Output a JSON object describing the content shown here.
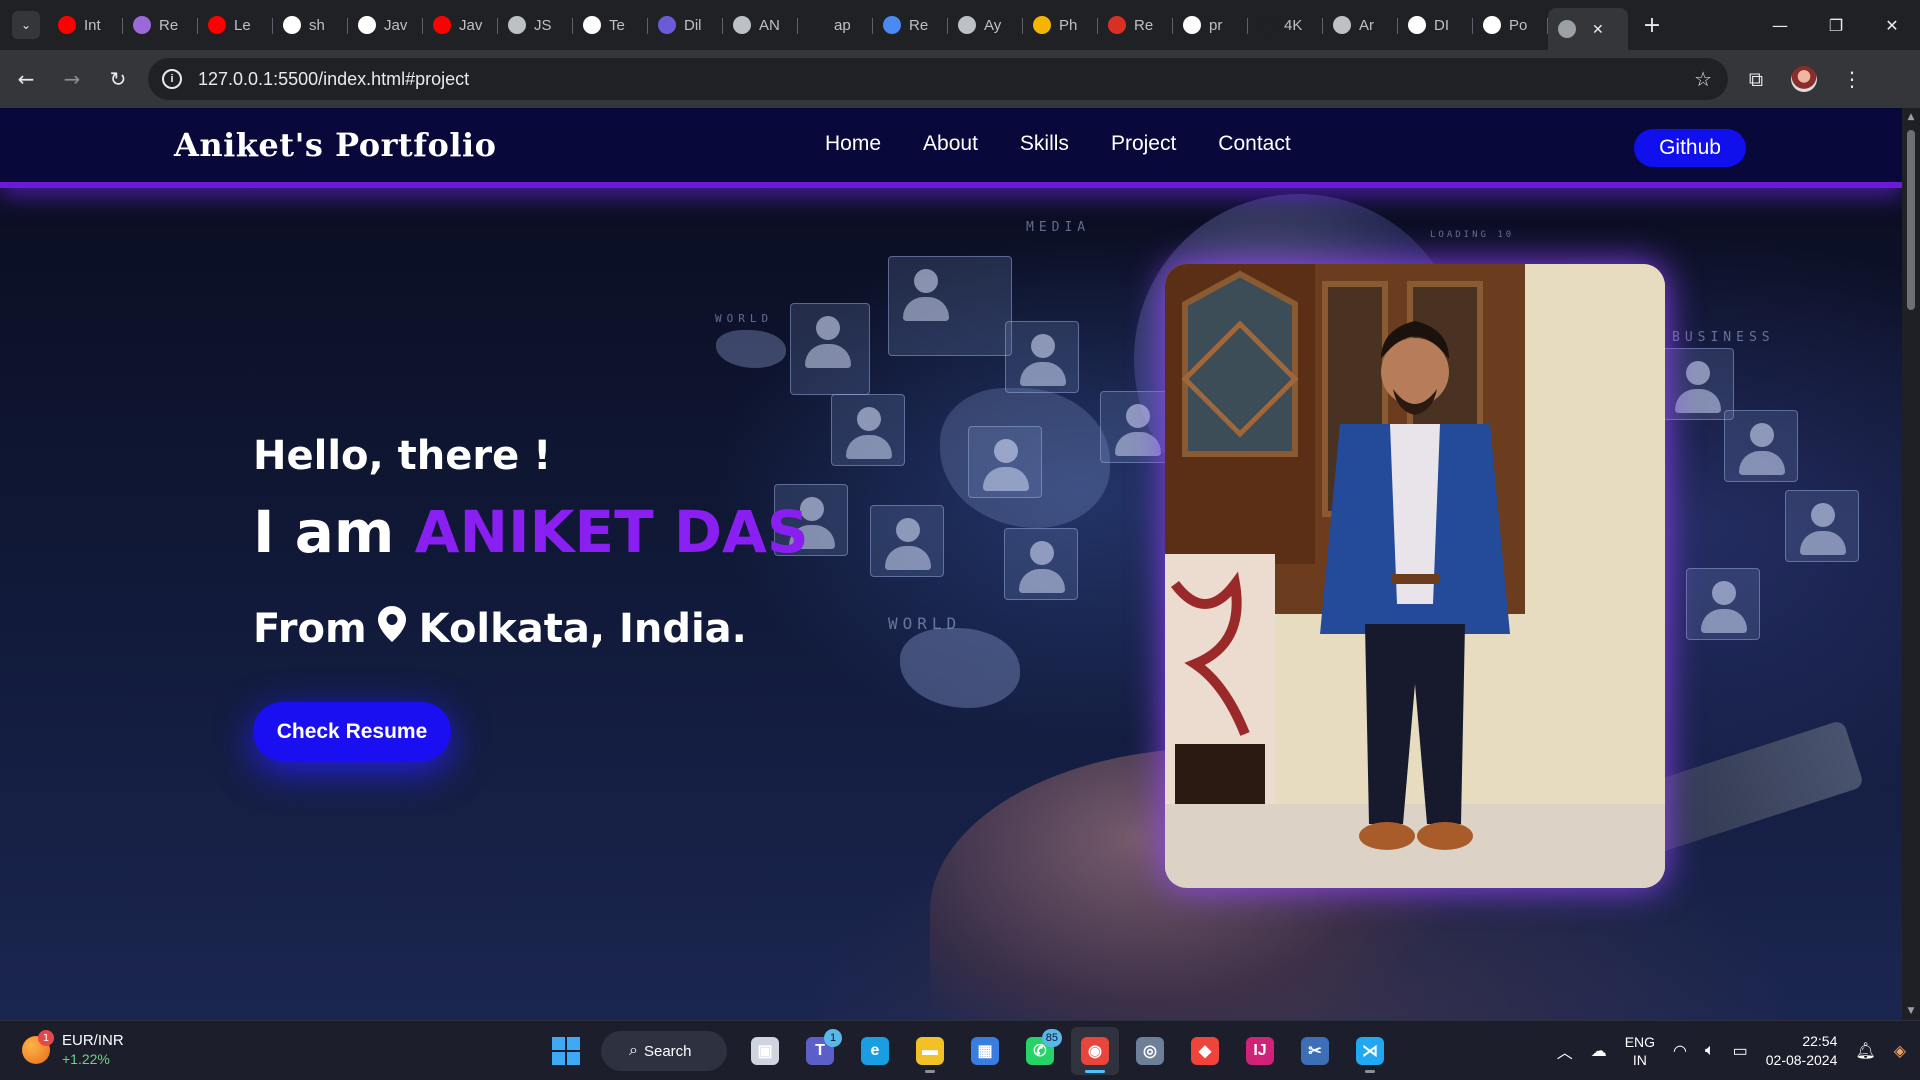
{
  "browser": {
    "tabs": [
      {
        "label": "Int",
        "icon": "youtube-icon",
        "color": "#ff0000"
      },
      {
        "label": "Re",
        "icon": "avatar-icon",
        "color": "#9b6ad8"
      },
      {
        "label": "Le",
        "icon": "youtube-icon",
        "color": "#ff0000"
      },
      {
        "label": "sh",
        "icon": "github-icon",
        "color": "#ffffff"
      },
      {
        "label": "Jav",
        "icon": "github-icon",
        "color": "#ffffff"
      },
      {
        "label": "Jav",
        "icon": "youtube-icon",
        "color": "#ff0000"
      },
      {
        "label": "JS",
        "icon": "globe-icon",
        "color": "#bdc1c6"
      },
      {
        "label": "Te",
        "icon": "github-icon",
        "color": "#ffffff"
      },
      {
        "label": "Dil",
        "icon": "spiral-icon",
        "color": "#6b5bd8"
      },
      {
        "label": "AN",
        "icon": "globe-icon",
        "color": "#bdc1c6"
      },
      {
        "label": "ap",
        "icon": "blank-icon",
        "color": "#202124"
      },
      {
        "label": "Re",
        "icon": "doc-icon",
        "color": "#4a8af4"
      },
      {
        "label": "Ay",
        "icon": "globe-icon",
        "color": "#bdc1c6"
      },
      {
        "label": "Ph",
        "icon": "pinwheel-icon",
        "color": "#f4b400"
      },
      {
        "label": "Re",
        "icon": "mail-icon",
        "color": "#d93025"
      },
      {
        "label": "pr",
        "icon": "google-icon",
        "color": "#ffffff"
      },
      {
        "label": "4K",
        "icon": "chevron-icon",
        "color": "#202124"
      },
      {
        "label": "Ar",
        "icon": "globe-icon",
        "color": "#bdc1c6"
      },
      {
        "label": "DI",
        "icon": "github-icon",
        "color": "#ffffff"
      },
      {
        "label": "Po",
        "icon": "github-icon",
        "color": "#ffffff"
      }
    ],
    "active_tab": {
      "label": "",
      "icon": "globe-icon"
    },
    "url": "127.0.0.1:5500/index.html#project"
  },
  "site": {
    "brand": "Aniket's Portfolio",
    "menu": [
      "Home",
      "About",
      "Skills",
      "Project",
      "Contact"
    ],
    "github_label": "Github",
    "hero": {
      "greeting": "Hello, there !",
      "iam_prefix": "I am",
      "name": "ANIKET DAS",
      "from_prefix": "From",
      "location": "Kolkata, India.",
      "resume_label": "Check Resume"
    },
    "decor_labels": [
      "MEDIA",
      "WORLD",
      "WORLD",
      "BUSINESS",
      "LOADING 10"
    ],
    "colors": {
      "accent": "#8a1ff2",
      "button": "#1a0ff0",
      "nav_bg": "#08083a"
    }
  },
  "taskbar": {
    "widget_badge": "1",
    "widget_title": "EUR/INR",
    "widget_change": "+1.22%",
    "search_label": "Search",
    "apps": [
      {
        "name": "task-view",
        "glyph": "▣",
        "color": "#d0d4de",
        "badge": ""
      },
      {
        "name": "teams",
        "glyph": "T",
        "color": "#5b5fc7",
        "badge": "1"
      },
      {
        "name": "edge",
        "glyph": "e",
        "color": "#1b9de2",
        "badge": ""
      },
      {
        "name": "file-explorer",
        "glyph": "▬",
        "color": "#f2c027",
        "badge": ""
      },
      {
        "name": "store",
        "glyph": "▦",
        "color": "#3a7de0",
        "badge": ""
      },
      {
        "name": "whatsapp",
        "glyph": "✆",
        "color": "#25d366",
        "badge": "85"
      },
      {
        "name": "chrome",
        "glyph": "◉",
        "color": "#e8453c",
        "badge": ""
      },
      {
        "name": "camera",
        "glyph": "◎",
        "color": "#6e7f99",
        "badge": ""
      },
      {
        "name": "anydesk",
        "glyph": "◆",
        "color": "#ef443b",
        "badge": ""
      },
      {
        "name": "intellij",
        "glyph": "IJ",
        "color": "#d1227a",
        "badge": ""
      },
      {
        "name": "snipping",
        "glyph": "✂",
        "color": "#3c6fb6",
        "badge": ""
      },
      {
        "name": "vscode",
        "glyph": "⋊",
        "color": "#22a7f2",
        "badge": ""
      }
    ],
    "lang_line1": "ENG",
    "lang_line2": "IN",
    "time": "22:54",
    "date": "02-08-2024"
  }
}
